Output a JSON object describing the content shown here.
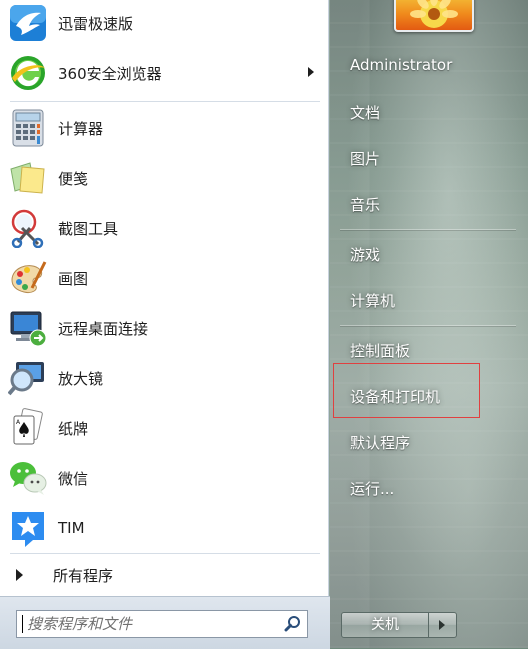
{
  "programs": [
    {
      "label": "迅雷极速版",
      "icon": "xunlei-bird-icon"
    },
    {
      "label": "360安全浏览器",
      "icon": "360-browser-icon",
      "has_submenu": true
    },
    {
      "label": "计算器",
      "icon": "calculator-icon"
    },
    {
      "label": "便笺",
      "icon": "sticky-notes-icon"
    },
    {
      "label": "截图工具",
      "icon": "snipping-tool-icon"
    },
    {
      "label": "画图",
      "icon": "paint-palette-icon"
    },
    {
      "label": "远程桌面连接",
      "icon": "remote-desktop-icon"
    },
    {
      "label": "放大镜",
      "icon": "magnifier-icon"
    },
    {
      "label": "纸牌",
      "icon": "solitaire-card-icon"
    },
    {
      "label": "微信",
      "icon": "wechat-icon"
    },
    {
      "label": "TIM",
      "icon": "tim-icon"
    }
  ],
  "all_programs_label": "所有程序",
  "search": {
    "placeholder": "搜索程序和文件"
  },
  "right_menu": {
    "user": "Administrator",
    "documents": "文档",
    "pictures": "图片",
    "music": "音乐",
    "games": "游戏",
    "computer": "计算机",
    "control_panel": "控制面板",
    "devices_printers": "设备和打印机",
    "default_programs": "默认程序",
    "run": "运行..."
  },
  "shutdown_label": "关机",
  "colors": {
    "highlight": "#e04040",
    "menu_text_right": "#ffffff"
  }
}
